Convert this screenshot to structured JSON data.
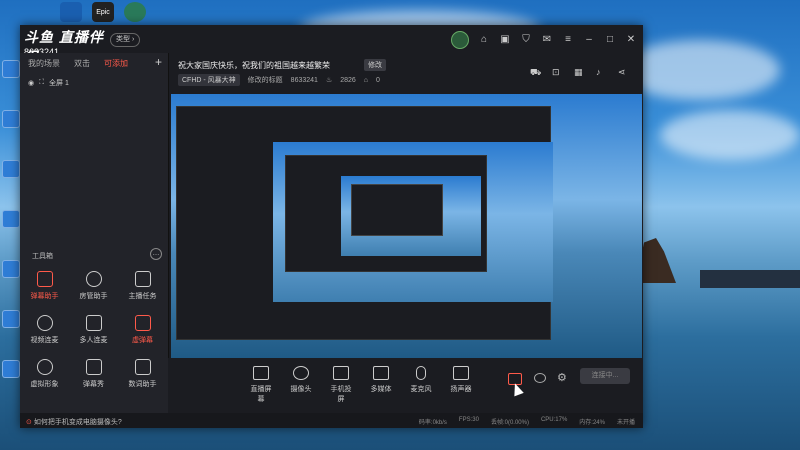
{
  "colors": {
    "accent": "#ff5a4a",
    "window_bg": "#1b1c21",
    "panel_bg": "#222329"
  },
  "app": {
    "logo": "斗鱼 直播伴侣",
    "room_id": "8633241",
    "type_button": "类型"
  },
  "titlebar_icons": [
    "avatar",
    "share-icon",
    "gift-icon",
    "shirt-icon",
    "mail-icon",
    "menu-icon",
    "minimize-icon",
    "maximize-icon",
    "close-icon"
  ],
  "left_panel": {
    "tabs": [
      "我的场景",
      "双击",
      "可添加"
    ],
    "scene": "全屏 1",
    "tools_title": "工具箱",
    "tools": [
      "弹幕助手",
      "房管助手",
      "主播任务",
      "视频连麦",
      "多人连麦",
      "虚弹幕",
      "虚拟形象",
      "弹幕秀",
      "数词助手"
    ]
  },
  "info": {
    "title": "祝大家国庆快乐，祝我们的祖国越来越繁荣",
    "edit": "修改",
    "category": "CFHD - 风暴大神",
    "category_edit": "修改的标题",
    "room": "8633241",
    "popularity": "2826",
    "followers": "0"
  },
  "bottom": {
    "items": [
      "直播屏幕",
      "摄像头",
      "手机投屏",
      "多媒体",
      "麦克风",
      "扬声器"
    ],
    "live_button": "连接中..."
  },
  "status": {
    "tip": "如何把手机变成电脑摄像头?",
    "stats": [
      "码率:0kb/s",
      "FPS:30",
      "丢帧:0(0.00%)",
      "CPU:17%",
      "内存:24%",
      "未开播"
    ]
  },
  "desktop": {
    "icons": [
      "Epic"
    ]
  }
}
